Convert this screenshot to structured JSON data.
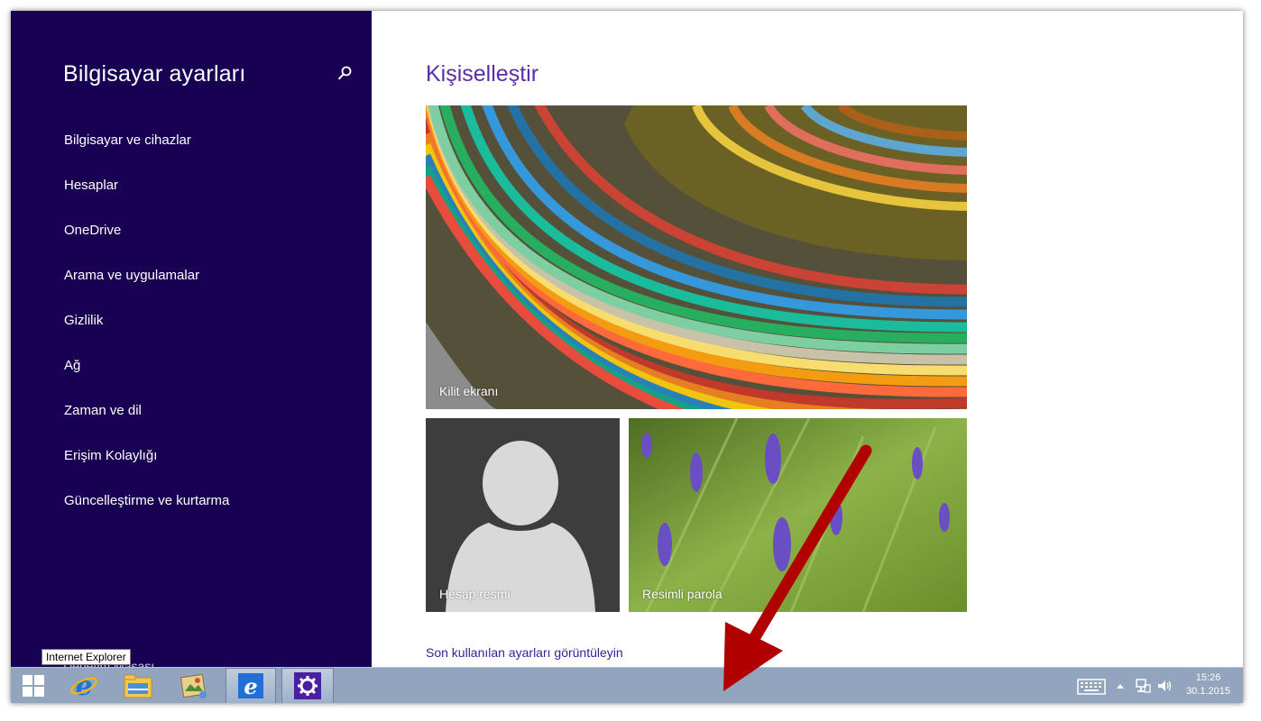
{
  "sidebar": {
    "title": "Bilgisayar ayarları",
    "search_icon": "search-icon",
    "items": [
      {
        "label": "Bilgisayar ve cihazlar"
      },
      {
        "label": "Hesaplar"
      },
      {
        "label": "OneDrive"
      },
      {
        "label": "Arama ve uygulamalar"
      },
      {
        "label": "Gizlilik"
      },
      {
        "label": "Ağ"
      },
      {
        "label": "Zaman ve dil"
      },
      {
        "label": "Erişim Kolaylığı"
      },
      {
        "label": "Güncelleştirme ve kurtarma"
      }
    ],
    "control_panel_label": "Denetim Masası"
  },
  "main": {
    "title": "Kişiselleştir",
    "tiles": {
      "lock_screen": "Kilit ekranı",
      "account_picture": "Hesap resmi",
      "picture_password": "Resimli parola"
    },
    "recent_link": "Son kullanılan ayarları görüntüleyin"
  },
  "taskbar": {
    "tooltip": "Internet Explorer",
    "apps": [
      "start-icon",
      "internet-explorer-icon",
      "file-explorer-icon",
      "photos-icon",
      "internet-explorer-pinned-icon",
      "settings-icon"
    ],
    "tray": {
      "time": "15:26",
      "date": "30.1.2015"
    }
  },
  "colors": {
    "sidebar_bg": "#180052",
    "accent": "#5b2ea8",
    "taskbar_bg": "#93a4be",
    "annotation_arrow": "#b00000"
  }
}
